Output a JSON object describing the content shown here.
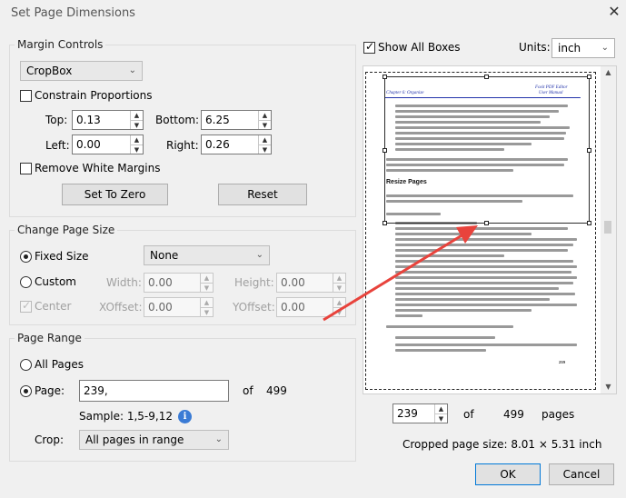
{
  "window": {
    "title": "Set Page Dimensions",
    "close_glyph": "✕"
  },
  "margin_controls": {
    "legend": "Margin Controls",
    "box_type": "CropBox",
    "constrain_label": "Constrain Proportions",
    "constrain_checked": false,
    "top_label": "Top:",
    "top_value": "0.13",
    "bottom_label": "Bottom:",
    "bottom_value": "6.25",
    "left_label": "Left:",
    "left_value": "0.00",
    "right_label": "Right:",
    "right_value": "0.26",
    "remove_white_label": "Remove White Margins",
    "remove_white_checked": false,
    "set_zero_label": "Set To Zero",
    "reset_label": "Reset"
  },
  "change_page_size": {
    "legend": "Change Page Size",
    "fixed_size_label": "Fixed Size",
    "fixed_size_value": "None",
    "custom_label": "Custom",
    "width_label": "Width:",
    "width_value": "0.00",
    "height_label": "Height:",
    "height_value": "0.00",
    "center_label": "Center",
    "xoffset_label": "XOffset:",
    "xoffset_value": "0.00",
    "yoffset_label": "YOffset:",
    "yoffset_value": "0.00",
    "selected": "fixed_size"
  },
  "page_range": {
    "legend": "Page Range",
    "all_pages_label": "All Pages",
    "page_label": "Page:",
    "page_value": "239,",
    "of_label": "of",
    "total_pages": "499",
    "sample_text": "Sample: 1,5-9,12",
    "crop_label": "Crop:",
    "crop_value": "All pages in range",
    "selected": "page"
  },
  "preview": {
    "show_all_boxes_label": "Show All Boxes",
    "show_all_boxes_checked": true,
    "units_label": "Units:",
    "units_value": "inch",
    "doc": {
      "brand": "Foxit PDF Editor",
      "manual": "User Manual",
      "chapter": "Chapter 6: Organize",
      "section_title": "Resize Pages",
      "page_number": "239"
    }
  },
  "navigator": {
    "current_page": "239",
    "of_label": "of",
    "total": "499",
    "pages_label": "pages"
  },
  "cropped_size": "Cropped page size:  8.01 × 5.31  inch",
  "buttons": {
    "ok": "OK",
    "cancel": "Cancel"
  },
  "icons": {
    "dropdown": "chevron-down-icon",
    "info": "info-icon",
    "close": "close-icon"
  },
  "colors": {
    "arrow": "#e8433c",
    "info": "#3a7bd5",
    "doc_heading": "#2233aa"
  }
}
